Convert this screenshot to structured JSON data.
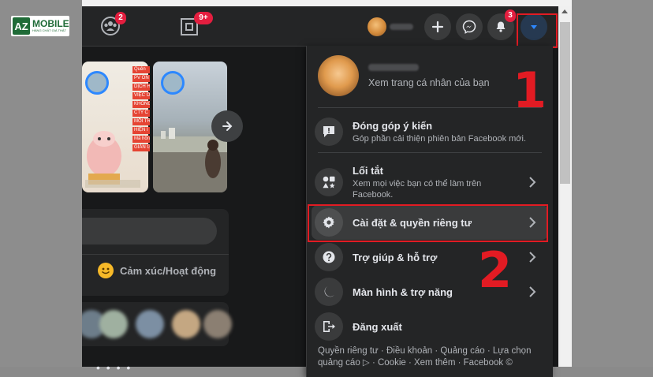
{
  "watermark": {
    "logo_mark": "AZ",
    "logo_text": "MOBILE",
    "tagline": "HÀNG CHẤT GIÁ THẬT"
  },
  "topbar": {
    "groups_badge": "2",
    "gaming_badge": "9+",
    "notifications_badge": "3"
  },
  "composer": {
    "feeling_label": "Cảm xúc/Hoạt động"
  },
  "story_cards": [
    "Quên",
    "PV ON",
    "DỊCH HỖ",
    "VIỆC ON",
    "KHÔNG C",
    "CTY C",
    "MỖI TRU",
    "HIỆN I",
    "Mã hồng",
    "GIẢN G"
  ],
  "menu": {
    "profile_sub": "Xem trang cá nhân của bạn",
    "feedback_title": "Đóng góp ý kiến",
    "feedback_sub": "Góp phần cải thiện phiên bản Facebook mới.",
    "shortcuts_title": "Lối tắt",
    "shortcuts_sub1": "Xem mọi việc bạn có thể làm trên",
    "shortcuts_sub2": "Facebook.",
    "settings_title": "Cài đặt & quyền riêng tư",
    "help_title": "Trợ giúp & hỗ trợ",
    "display_title": "Màn hình & trợ năng",
    "logout_title": "Đăng xuất",
    "footer_line1": "Quyền riêng tư · Điều khoản · Quảng cáo · Lựa chọn",
    "footer_line2": "quảng cáo ▷ · Cookie · Xem thêm · Facebook ©"
  },
  "annotations": {
    "step1": "1",
    "step2": "2",
    "highlight_color": "#e21b23"
  }
}
